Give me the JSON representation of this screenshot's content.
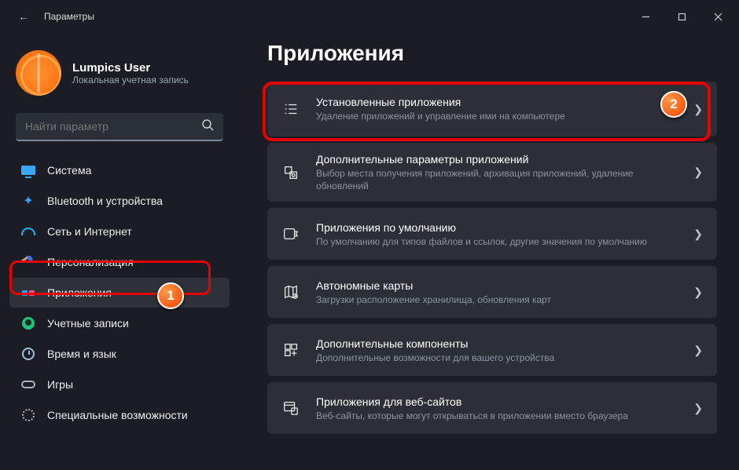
{
  "titlebar": {
    "title": "Параметры"
  },
  "account": {
    "name": "Lumpics User",
    "sub": "Локальная учетная запись"
  },
  "search": {
    "placeholder": "Найти параметр"
  },
  "sidebar": {
    "items": [
      {
        "label": "Система"
      },
      {
        "label": "Bluetooth и устройства"
      },
      {
        "label": "Сеть и Интернет"
      },
      {
        "label": "Персонализация"
      },
      {
        "label": "Приложения"
      },
      {
        "label": "Учетные записи"
      },
      {
        "label": "Время и язык"
      },
      {
        "label": "Игры"
      },
      {
        "label": "Специальные возможности"
      }
    ]
  },
  "page": {
    "title": "Приложения"
  },
  "cards": [
    {
      "title": "Установленные приложения",
      "sub": "Удаление приложений и управление ими на компьютере"
    },
    {
      "title": "Дополнительные параметры приложений",
      "sub": "Выбор места получения приложений, архивация приложений, удаление обновлений"
    },
    {
      "title": "Приложения по умолчанию",
      "sub": "По умолчанию для типов файлов и ссылок, другие значения по умолчанию"
    },
    {
      "title": "Автономные карты",
      "sub": "Загрузки расположение хранилища, обновления карт"
    },
    {
      "title": "Дополнительные компоненты",
      "sub": "Дополнительные возможности для вашего устройства"
    },
    {
      "title": "Приложения для веб-сайтов",
      "sub": "Веб-сайты, которые могут открываться в приложении вместо браузера"
    }
  ],
  "annotations": {
    "badge1": "1",
    "badge2": "2"
  }
}
